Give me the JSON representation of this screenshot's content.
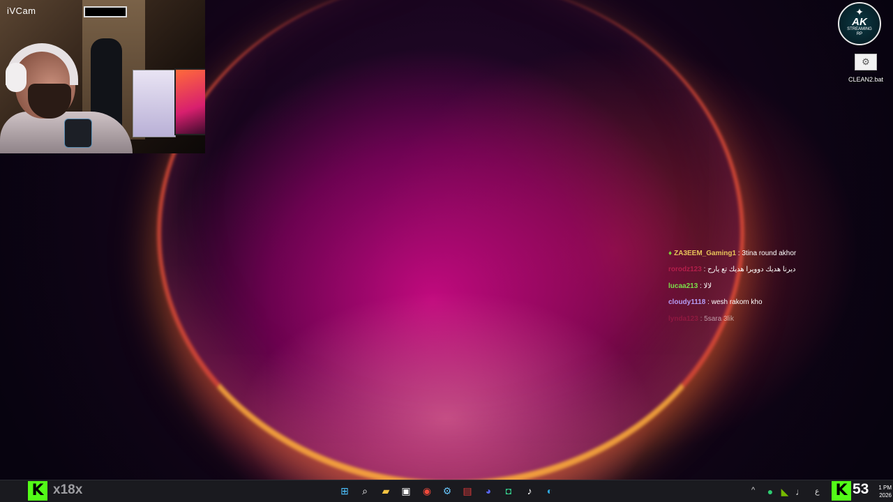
{
  "webcam": {
    "label": "iVCam"
  },
  "desktop": {
    "logo": {
      "wing_glyph": "✦",
      "text": "AK",
      "subtitle": "STREAMING\nRP"
    },
    "icons": [
      {
        "label": "CLEAN2.bat",
        "icon": "gear-file-icon"
      }
    ]
  },
  "chat": {
    "messages": [
      {
        "user": "ZA3EEM_Gaming1",
        "user_color": "#e8c35a",
        "text": "3tina round akhor",
        "badge": true,
        "faded": false
      },
      {
        "user": "rorodz123",
        "user_color": "#b31e4a",
        "text": "ديرنا هديك دوويرا هديك تع يارح",
        "badge": false,
        "faded": false
      },
      {
        "user": "lucaa213",
        "user_color": "#7be04a",
        "text": "لالا",
        "badge": false,
        "faded": false
      },
      {
        "user": "cloudy1118",
        "user_color": "#b59cf5",
        "text": "wesh rakom kho",
        "badge": false,
        "faded": false
      },
      {
        "user": "lynda123",
        "user_color": "#b31e4a",
        "text": "5sara 3lik",
        "badge": false,
        "faded": true
      }
    ]
  },
  "taskbar": {
    "kick_name": "x18x",
    "kick_glyph": "K",
    "apps": [
      {
        "name": "start-icon",
        "glyph": "⊞",
        "color": "#4cc2ff"
      },
      {
        "name": "search-icon",
        "glyph": "⌕",
        "color": "#ffffff"
      },
      {
        "name": "file-explorer-icon",
        "glyph": "▰",
        "color": "#f5c342"
      },
      {
        "name": "store-icon",
        "glyph": "▣",
        "color": "#ffffff"
      },
      {
        "name": "chrome-icon",
        "glyph": "◉",
        "color": "#f14a3c"
      },
      {
        "name": "steam-icon",
        "glyph": "⚙",
        "color": "#66c0f4"
      },
      {
        "name": "wuthering-waves-icon",
        "glyph": "▤",
        "color": "#e33b3b"
      },
      {
        "name": "discord-icon",
        "glyph": "◕",
        "color": "#5865f2"
      },
      {
        "name": "app-green-icon",
        "glyph": "◘",
        "color": "#34c98a"
      },
      {
        "name": "tiktok-icon",
        "glyph": "♪",
        "color": "#ffffff"
      },
      {
        "name": "edge-icon",
        "glyph": "◐",
        "color": "#2fa9e0"
      }
    ],
    "tray": {
      "chevron": "^",
      "lang": "ع",
      "viewer_count": "53",
      "time": "1 PM",
      "date": "2026"
    }
  }
}
